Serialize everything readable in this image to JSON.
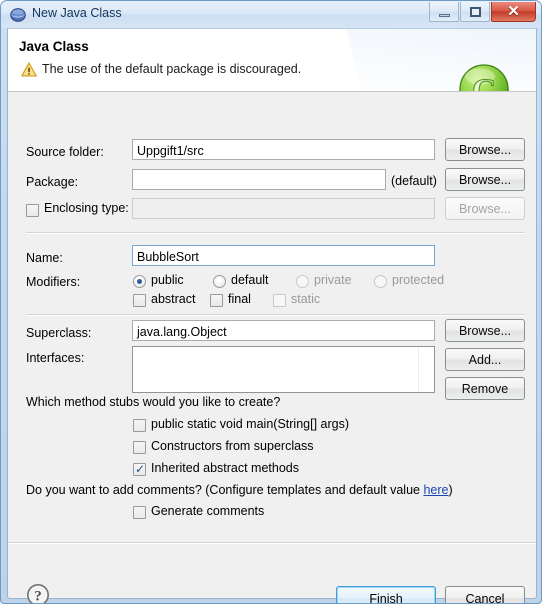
{
  "window": {
    "title": "New Java Class",
    "icon": "eclipse-globe-icon",
    "controls": {
      "minimize": "minimize-button",
      "maximize": "maximize-button",
      "close": "close-button",
      "close_glyph": "✕"
    }
  },
  "header": {
    "title": "Java Class",
    "message": "The use of the default package is discouraged.",
    "warning_icon": "warning-triangle-icon",
    "badge_icon": "java-class-badge-icon",
    "badge_letter": "C"
  },
  "form": {
    "source_folder": {
      "label": "Source folder:",
      "value": "Uppgift1/src",
      "browse_label": "Browse..."
    },
    "package": {
      "label": "Package:",
      "value": "",
      "placeholder": "",
      "hint": "(default)",
      "browse_label": "Browse..."
    },
    "enclosing_type": {
      "label": "Enclosing type:",
      "checked": false,
      "value": "",
      "browse_label": "Browse...",
      "enabled": false
    },
    "name": {
      "label": "Name:",
      "value": "BubbleSort"
    },
    "modifiers": {
      "label": "Modifiers:",
      "access": [
        {
          "label": "public",
          "selected": true,
          "enabled": true
        },
        {
          "label": "default",
          "selected": false,
          "enabled": true
        },
        {
          "label": "private",
          "selected": false,
          "enabled": false
        },
        {
          "label": "protected",
          "selected": false,
          "enabled": false
        }
      ],
      "flags": [
        {
          "label": "abstract",
          "checked": false,
          "enabled": true
        },
        {
          "label": "final",
          "checked": false,
          "enabled": true
        },
        {
          "label": "static",
          "checked": false,
          "enabled": false
        }
      ]
    },
    "superclass": {
      "label": "Superclass:",
      "value": "java.lang.Object",
      "browse_label": "Browse..."
    },
    "interfaces": {
      "label": "Interfaces:",
      "items": [],
      "add_label": "Add...",
      "remove_label": "Remove"
    }
  },
  "stubs": {
    "question": "Which method stubs would you like to create?",
    "options": [
      {
        "label": "public static void main(String[] args)",
        "checked": false
      },
      {
        "label": "Constructors from superclass",
        "checked": false
      },
      {
        "label": "Inherited abstract methods",
        "checked": true
      }
    ]
  },
  "comments": {
    "question_prefix": "Do you want to add comments? (Configure templates and default value ",
    "link": "here",
    "question_suffix": ")",
    "option": {
      "label": "Generate comments",
      "checked": false
    }
  },
  "buttonbar": {
    "help_icon": "help-question-icon",
    "finish_label": "Finish",
    "cancel_label": "Cancel"
  },
  "colors": {
    "accent": "#3d9ed8",
    "link": "#1b46b4",
    "close_button": "#c33c29",
    "badge_green": "#7ac943",
    "warning_yellow": "#f0b323"
  }
}
